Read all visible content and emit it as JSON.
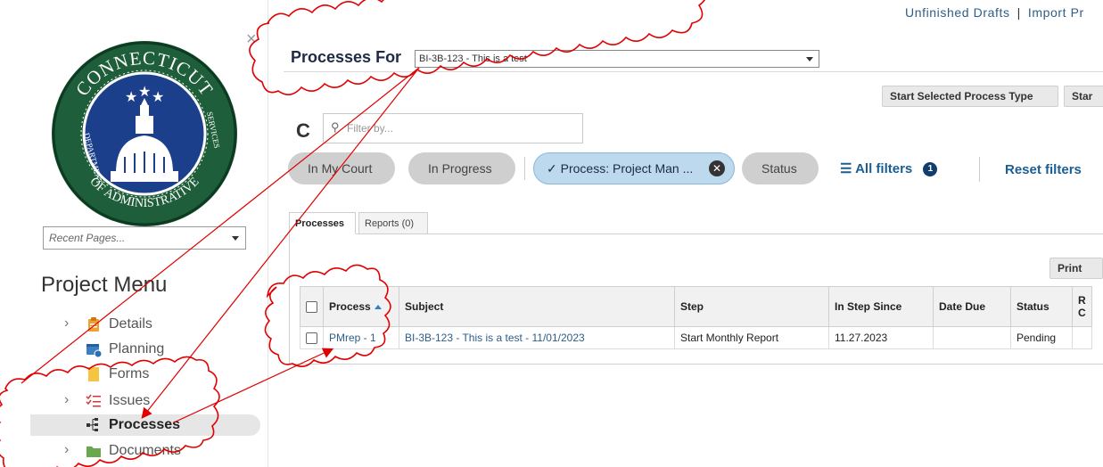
{
  "sidebar": {
    "logo_text": {
      "top": "CONNECTICUT",
      "left": "DEPARTMENT",
      "bottom": "OF ADMINISTRATIVE",
      "right": "SERVICES"
    },
    "recent_pages_placeholder": "Recent Pages...",
    "project_menu_title": "Project Menu",
    "items": [
      {
        "label": "Details",
        "icon": "clipboard-icon",
        "has_chevron": true
      },
      {
        "label": "Planning",
        "icon": "calendar-icon",
        "has_chevron": false
      },
      {
        "label": "Forms",
        "icon": "forms-icon",
        "has_chevron": false
      },
      {
        "label": "Issues",
        "icon": "checklist-icon",
        "has_chevron": true
      },
      {
        "label": "Processes",
        "icon": "process-tree-icon",
        "has_chevron": false,
        "active": true
      },
      {
        "label": "Documents",
        "icon": "folder-icon",
        "has_chevron": true
      }
    ]
  },
  "header": {
    "processes_for_label": "Processes For",
    "process_select_value": "BI-3B-123 - This is a test",
    "links": {
      "unfinished_drafts": "Unfinished Drafts",
      "separator": "|",
      "import": "Import Pr"
    }
  },
  "toolbar": {
    "start_selected_label": "Start Selected Process Type",
    "start_label": "Star",
    "filter_placeholder": "Filter by..."
  },
  "filters": {
    "in_my_court": "In My Court",
    "in_progress": "In Progress",
    "process_chip": "Process: Project Man ...",
    "status": "Status",
    "all_filters": "All filters",
    "all_filters_count": "1",
    "reset_filters": "Reset filters"
  },
  "tabs": [
    {
      "label": "Processes",
      "active": true
    },
    {
      "label": "Reports (0)",
      "active": false
    }
  ],
  "print_label": "Print",
  "table": {
    "headers": {
      "process": "Process",
      "subject": "Subject",
      "step": "Step",
      "in_step_since": "In Step Since",
      "date_due": "Date Due",
      "status": "Status",
      "last_r": "R",
      "last_c": "C"
    },
    "rows": [
      {
        "process": "PMrep - 1",
        "subject": "BI-3B-123 - This is a test - 11/01/2023",
        "step": "Start Monthly Report",
        "in_step_since": "11.27.2023",
        "date_due": "",
        "status": "Pending"
      }
    ]
  },
  "colors": {
    "annotation": "#e00000",
    "link": "#2e5d88",
    "chip_blue": "#bcd9ee",
    "logo_green": "#1f5e3a"
  }
}
